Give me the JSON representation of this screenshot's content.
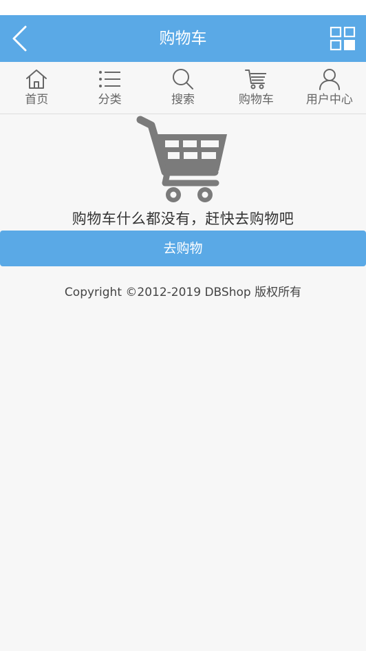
{
  "header": {
    "title": "购物车",
    "back_icon": "chevron-left-icon",
    "menu_icon": "grid-menu-icon",
    "background_color": "#5aa9e6"
  },
  "nav": {
    "items": [
      {
        "label": "首页",
        "icon": "home-icon"
      },
      {
        "label": "分类",
        "icon": "list-icon"
      },
      {
        "label": "搜索",
        "icon": "search-icon"
      },
      {
        "label": "购物车",
        "icon": "cart-icon"
      },
      {
        "label": "用户中心",
        "icon": "user-icon"
      }
    ]
  },
  "empty_state": {
    "icon": "shopping-cart-icon",
    "message": "购物车什么都没有，赶快去购物吧",
    "button_label": "去购物"
  },
  "footer": {
    "copyright": "Copyright ©2012-2019 DBShop 版权所有"
  }
}
